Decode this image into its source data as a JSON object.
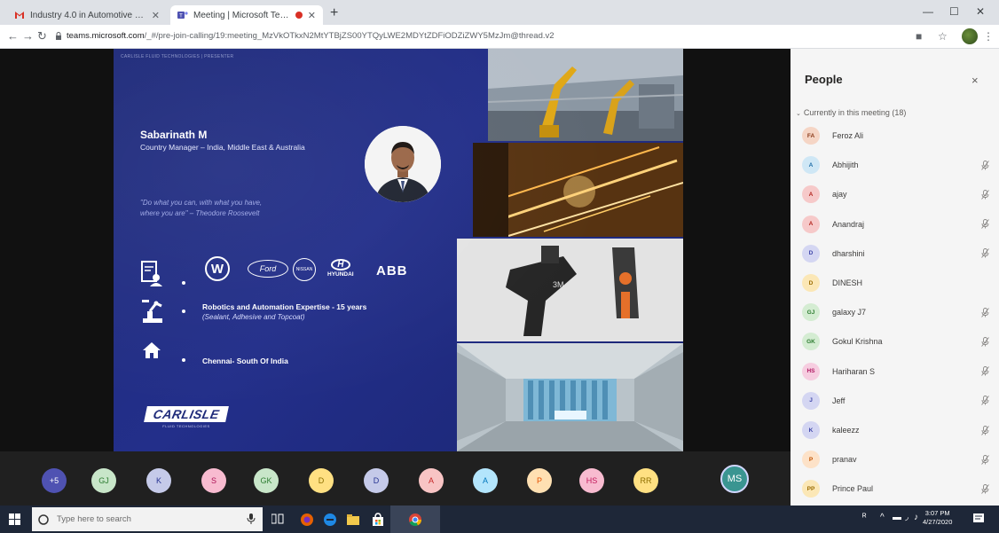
{
  "browser": {
    "tabs": [
      {
        "title": "Industry 4.0 in Automotive Plan",
        "icon": "gmail-icon",
        "active": false
      },
      {
        "title": "Meeting | Microsoft Teams",
        "icon": "teams-icon",
        "active": true,
        "recording": true
      }
    ],
    "new_tab": "+",
    "url_host": "teams.microsoft.com",
    "url_path": "/_#/pre-join-calling/19:meeting_MzVkOTkxN2MtYTBjZS00YTQyLWE2MDYtZDFiODZiZWY5MzJm@thread.v2"
  },
  "slide": {
    "header": "CARLISLE FLUID TECHNOLOGIES | PRESENTER",
    "name": "Sabarinath M",
    "role": "Country Manager – India, Middle East & Australia",
    "quote_line1": "\"Do what you can, with what you have,",
    "quote_line2": "where you are\" – Theodore Roosevelt",
    "brands": {
      "vw": "W",
      "ford": "Ford",
      "nissan": "NISSAN",
      "hyundai": "HYUNDAI",
      "hyundai_mark": "H",
      "abb": "ABB"
    },
    "expertise": "Robotics and Automation Expertise - 15 years",
    "expertise_sub": "(Sealant, Adhesive and Topcoat)",
    "location": "Chennai- South Of India",
    "logo": "CARLISLE",
    "logo_sub": "FLUID TECHNOLOGIES"
  },
  "strip": {
    "avatars": [
      {
        "initials": "+5",
        "bg": "#4f52b2",
        "fg": "#ffffff"
      },
      {
        "initials": "GJ",
        "bg": "#c8e6c9",
        "fg": "#2e7d32"
      },
      {
        "initials": "K",
        "bg": "#c5cae9",
        "fg": "#283593"
      },
      {
        "initials": "S",
        "bg": "#f8bbd0",
        "fg": "#ad1457"
      },
      {
        "initials": "GK",
        "bg": "#c8e6c9",
        "fg": "#2e7d32"
      },
      {
        "initials": "D",
        "bg": "#ffe082",
        "fg": "#8d6e00"
      },
      {
        "initials": "D",
        "bg": "#c5cae9",
        "fg": "#283593"
      },
      {
        "initials": "A",
        "bg": "#f8c4c4",
        "fg": "#c62828"
      },
      {
        "initials": "A",
        "bg": "#b3e5fc",
        "fg": "#0277bd"
      },
      {
        "initials": "P",
        "bg": "#ffe0b2",
        "fg": "#e65100"
      },
      {
        "initials": "HS",
        "bg": "#f8bbd0",
        "fg": "#c2185b"
      },
      {
        "initials": "RR",
        "bg": "#ffe082",
        "fg": "#8d6e00"
      }
    ],
    "self": "MS"
  },
  "people": {
    "title": "People",
    "close": "×",
    "section": "Currently in this meeting (18)",
    "members": [
      {
        "initials": "FA",
        "name": "Feroz Ali",
        "bg": "#f5d5c5",
        "fg": "#8a3a1a",
        "muted": false
      },
      {
        "initials": "A",
        "name": "Abhijith",
        "bg": "#cfe7f5",
        "fg": "#1f6ea8",
        "muted": true
      },
      {
        "initials": "A",
        "name": "ajay",
        "bg": "#f6c9c9",
        "fg": "#b3261e",
        "muted": true
      },
      {
        "initials": "A",
        "name": "Anandraj",
        "bg": "#f6c9c9",
        "fg": "#b3261e",
        "muted": true
      },
      {
        "initials": "D",
        "name": "dharshini",
        "bg": "#d4d6f2",
        "fg": "#3f46a8",
        "muted": true
      },
      {
        "initials": "D",
        "name": "DINESH",
        "bg": "#fbe7b6",
        "fg": "#9a6b00",
        "muted": false
      },
      {
        "initials": "GJ",
        "name": "galaxy J7",
        "bg": "#d4ecd2",
        "fg": "#2f7d32",
        "muted": true
      },
      {
        "initials": "GK",
        "name": "Gokul Krishna",
        "bg": "#d4ecd2",
        "fg": "#2f7d32",
        "muted": true
      },
      {
        "initials": "HS",
        "name": "Hariharan S",
        "bg": "#f6cde0",
        "fg": "#b01a63",
        "muted": true
      },
      {
        "initials": "J",
        "name": "Jeff",
        "bg": "#d4d6f2",
        "fg": "#3f46a8",
        "muted": true
      },
      {
        "initials": "K",
        "name": "kaleezz",
        "bg": "#d4d6f2",
        "fg": "#3f46a8",
        "muted": true
      },
      {
        "initials": "P",
        "name": "pranav",
        "bg": "#fde2c8",
        "fg": "#c25400",
        "muted": true
      },
      {
        "initials": "PP",
        "name": "Prince Paul",
        "bg": "#fbe7b6",
        "fg": "#9a6b00",
        "muted": true
      }
    ]
  },
  "taskbar": {
    "search_placeholder": "Type here to search",
    "time": "3:07 PM",
    "date": "4/27/2020"
  }
}
